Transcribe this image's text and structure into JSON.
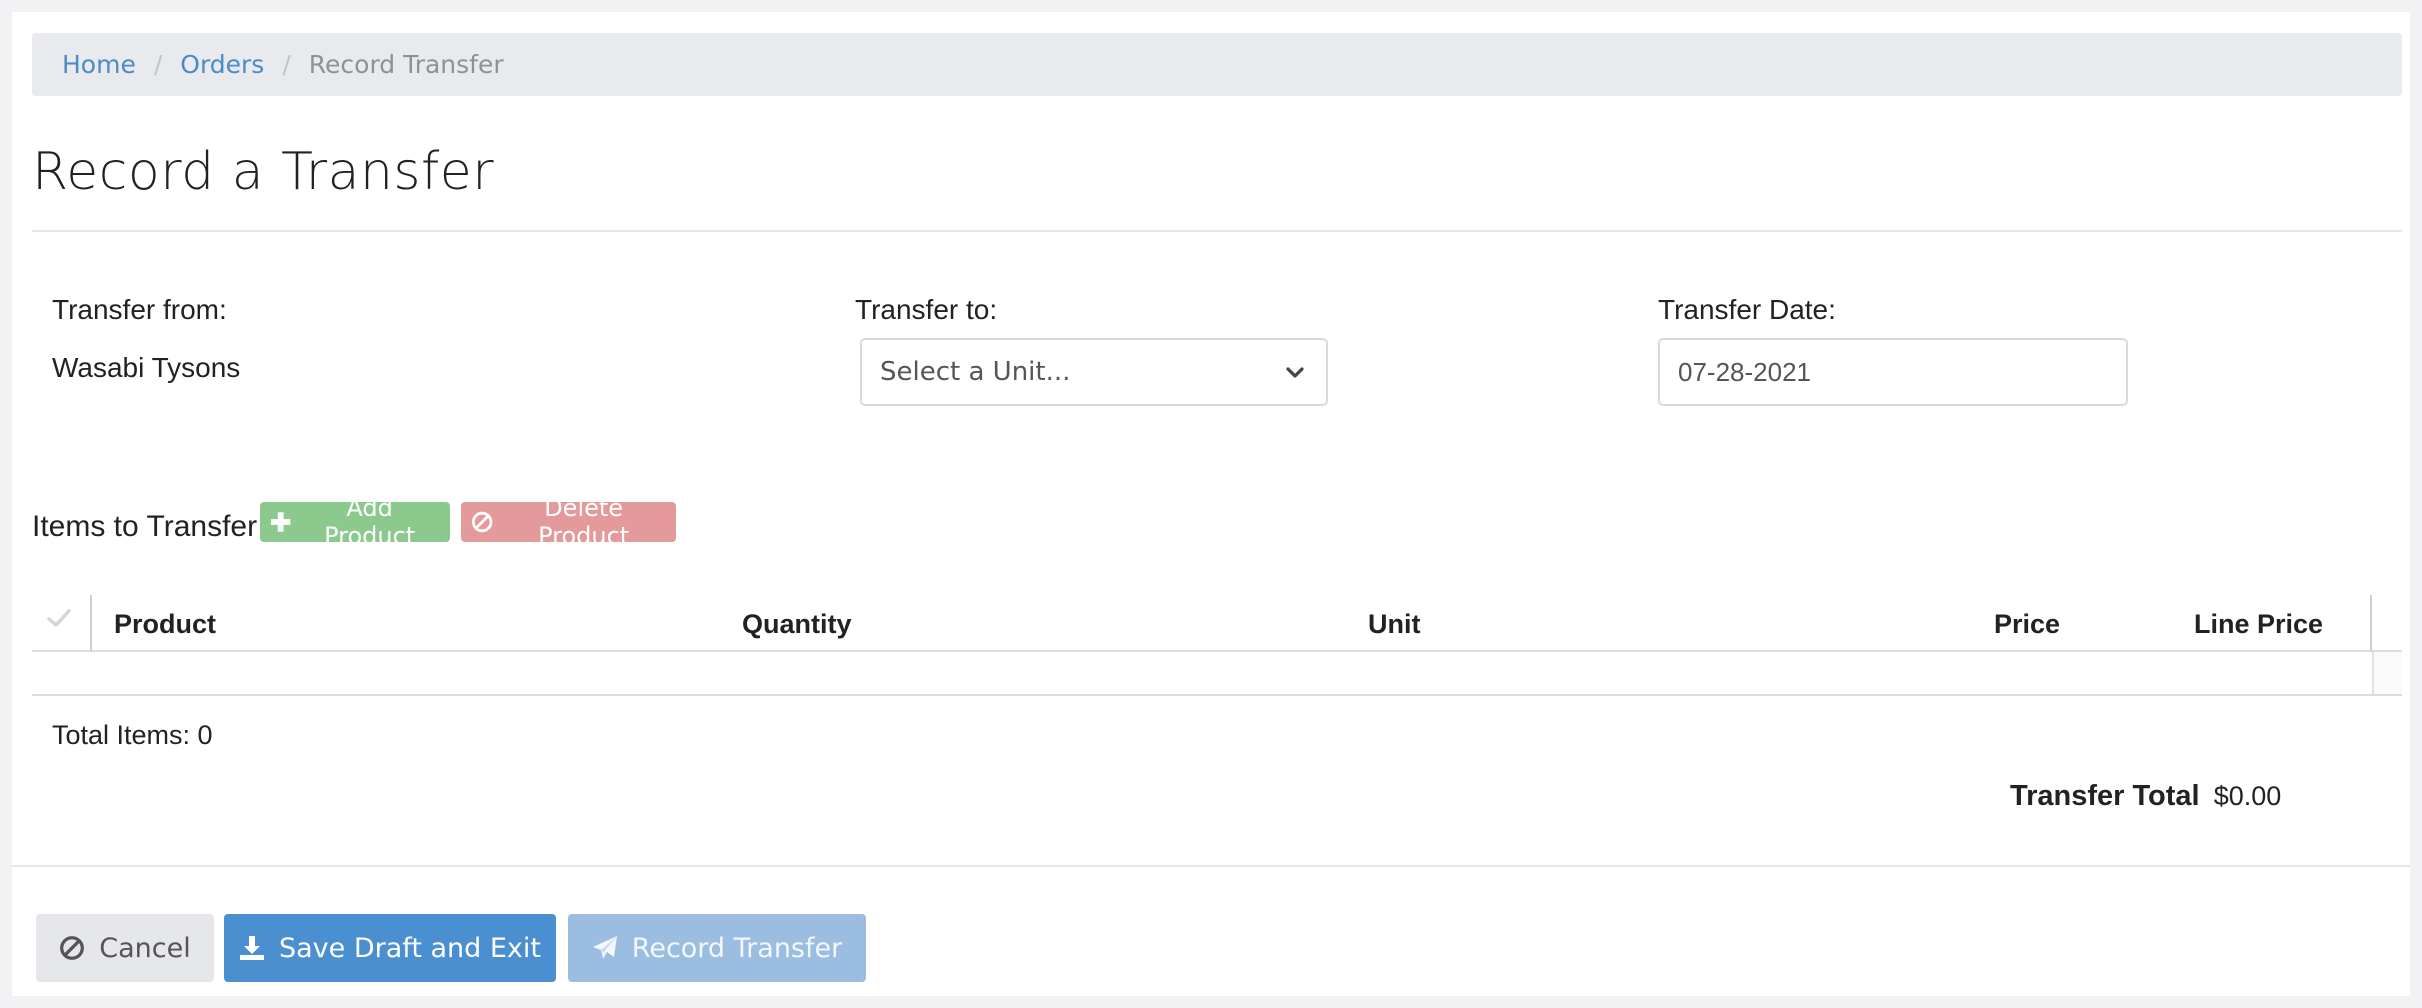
{
  "breadcrumb": {
    "items": [
      {
        "label": "Home"
      },
      {
        "label": "Orders"
      },
      {
        "label": "Record Transfer"
      }
    ],
    "separator": "/"
  },
  "page": {
    "title": "Record a Transfer"
  },
  "transfer": {
    "from_label": "Transfer from:",
    "from_value": "Wasabi Tysons",
    "to_label": "Transfer to:",
    "to_placeholder": "Select a Unit...",
    "date_label": "Transfer Date:",
    "date_value": "07-28-2021"
  },
  "items": {
    "label": "Items to Transfer",
    "add_button": "Add Product",
    "delete_button": "Delete Product",
    "columns": [
      "Product",
      "Quantity",
      "Unit",
      "Price",
      "Line Price"
    ],
    "rows": []
  },
  "summary": {
    "total_items": "Total Items: 0",
    "transfer_total_label": "Transfer Total",
    "transfer_total_value": "$0.00"
  },
  "actions": {
    "cancel": "Cancel",
    "save_draft": "Save Draft and Exit",
    "record": "Record Transfer"
  },
  "icons": {
    "add": "plus-icon",
    "delete": "ban-icon",
    "cancel": "ban-icon",
    "save": "download-icon",
    "record": "paper-plane-icon",
    "select": "chevron-down-icon",
    "check_all": "check-icon"
  },
  "colors": {
    "link": "#4a8cc8",
    "add_button": "#8cc98c",
    "delete_button": "#e49a9a",
    "save_button": "#4a8fcf",
    "record_button": "#9bbde2",
    "cancel_button": "#e6e7ea"
  }
}
